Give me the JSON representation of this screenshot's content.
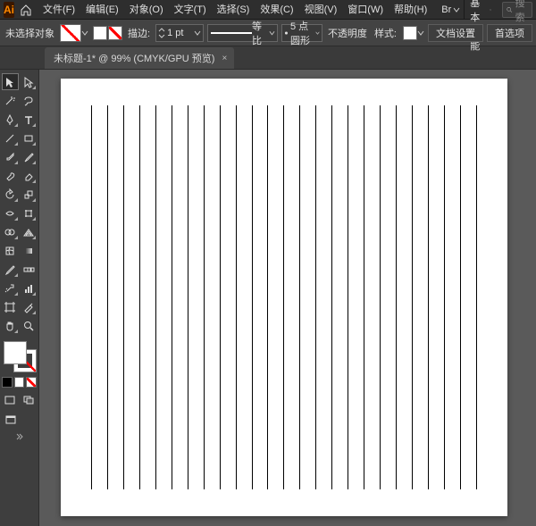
{
  "app": {
    "logo": "Ai"
  },
  "menubar": {
    "items": [
      {
        "label": "文件(F)"
      },
      {
        "label": "编辑(E)"
      },
      {
        "label": "对象(O)"
      },
      {
        "label": "文字(T)"
      },
      {
        "label": "选择(S)"
      },
      {
        "label": "效果(C)"
      },
      {
        "label": "视图(V)"
      },
      {
        "label": "窗口(W)"
      },
      {
        "label": "帮助(H)"
      }
    ],
    "bridge_label": "Br",
    "workspace": "传统基本功能",
    "search_placeholder": "搜索"
  },
  "controlbar": {
    "selection": "未选择对象",
    "stroke_label": "描边:",
    "stroke_value": "1 pt",
    "profile_label": "等比",
    "brush_value": "5 点圆形",
    "opacity_label": "不透明度",
    "style_label": "样式:",
    "doc_setup": "文档设置",
    "prefs": "首选项"
  },
  "document_tab": {
    "title": "未标题-1* @ 99% (CMYK/GPU 预览)"
  },
  "artboard": {
    "line_count": 25
  }
}
